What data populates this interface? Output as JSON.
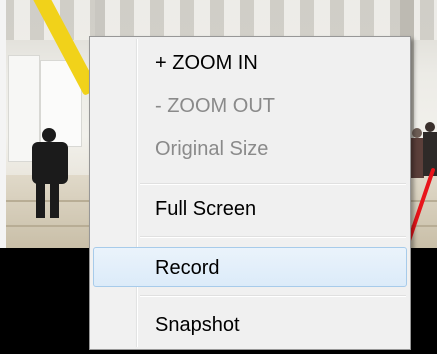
{
  "context_menu": {
    "items": [
      {
        "label": "+ ZOOM IN",
        "enabled": true
      },
      {
        "label": "- ZOOM OUT",
        "enabled": false
      },
      {
        "label": "Original Size",
        "enabled": false
      },
      {
        "label": "Full Screen",
        "enabled": true
      },
      {
        "label": "Record",
        "enabled": true,
        "highlighted": true
      },
      {
        "label": "Snapshot",
        "enabled": true
      }
    ]
  },
  "colors": {
    "highlight_fill": "#dcebf9",
    "highlight_border": "#a7cbea",
    "disabled_text": "#8a8a8a",
    "annotation_arrow": "#e8141a"
  }
}
